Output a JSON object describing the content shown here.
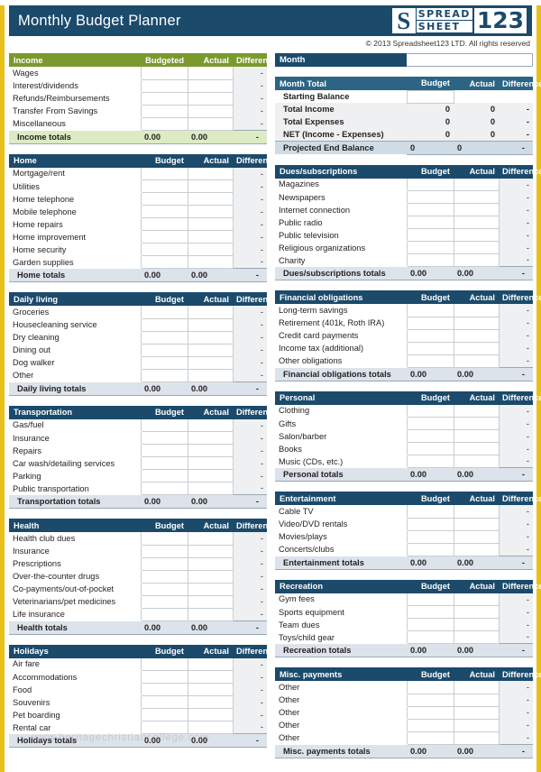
{
  "header": {
    "title": "Monthly Budget Planner",
    "copyright": "© 2013 Spreadsheet123 LTD. All rights reserved",
    "logo": {
      "mark": "S",
      "word1": "SPREAD",
      "word2": "SHEET",
      "number": "123"
    }
  },
  "watermark": "www.heritagechristiancollege.com",
  "colors": {
    "header_navy": "#1B4A6B",
    "income_green": "#7A9A2E",
    "total_blue": "#2C6484",
    "border_gold": "#E8C018",
    "totals_row": "#DCE3EA",
    "income_totals_row": "#DDEBC4",
    "difference_cell": "#EFF0F1"
  },
  "month": {
    "label": "Month",
    "value": "",
    "placeholder": ""
  },
  "columns": {
    "left": [
      {
        "key": "income",
        "style": "income",
        "headers": {
          "name": "Income",
          "budget": "Budgeted",
          "actual": "Actual",
          "difference": "Difference"
        },
        "rows": [
          {
            "name": "Wages",
            "budget": "",
            "actual": "",
            "difference": "-"
          },
          {
            "name": "Interest/dividends",
            "budget": "",
            "actual": "",
            "difference": "-"
          },
          {
            "name": "Refunds/Reimbursements",
            "budget": "",
            "actual": "",
            "difference": "-"
          },
          {
            "name": "Transfer From Savings",
            "budget": "",
            "actual": "",
            "difference": "-"
          },
          {
            "name": "Miscellaneous",
            "budget": "",
            "actual": "",
            "difference": "-"
          }
        ],
        "totals": {
          "name": "Income totals",
          "budget": "0.00",
          "actual": "0.00",
          "difference": "-"
        }
      },
      {
        "key": "home",
        "style": "expense",
        "headers": {
          "name": "Home",
          "budget": "Budget",
          "actual": "Actual",
          "difference": "Difference"
        },
        "rows": [
          {
            "name": "Mortgage/rent",
            "budget": "",
            "actual": "",
            "difference": "-"
          },
          {
            "name": "Utilities",
            "budget": "",
            "actual": "",
            "difference": "-"
          },
          {
            "name": "Home telephone",
            "budget": "",
            "actual": "",
            "difference": "-"
          },
          {
            "name": "Mobile telephone",
            "budget": "",
            "actual": "",
            "difference": "-"
          },
          {
            "name": "Home repairs",
            "budget": "",
            "actual": "",
            "difference": "-"
          },
          {
            "name": "Home improvement",
            "budget": "",
            "actual": "",
            "difference": "-"
          },
          {
            "name": "Home security",
            "budget": "",
            "actual": "",
            "difference": "-"
          },
          {
            "name": "Garden supplies",
            "budget": "",
            "actual": "",
            "difference": "-"
          }
        ],
        "totals": {
          "name": "Home totals",
          "budget": "0.00",
          "actual": "0.00",
          "difference": "-"
        }
      },
      {
        "key": "daily-living",
        "style": "expense",
        "headers": {
          "name": "Daily living",
          "budget": "Budget",
          "actual": "Actual",
          "difference": "Difference"
        },
        "rows": [
          {
            "name": "Groceries",
            "budget": "",
            "actual": "",
            "difference": "-"
          },
          {
            "name": "Housecleaning service",
            "budget": "",
            "actual": "",
            "difference": "-"
          },
          {
            "name": "Dry cleaning",
            "budget": "",
            "actual": "",
            "difference": "-"
          },
          {
            "name": "Dining out",
            "budget": "",
            "actual": "",
            "difference": "-"
          },
          {
            "name": "Dog walker",
            "budget": "",
            "actual": "",
            "difference": "-"
          },
          {
            "name": "Other",
            "budget": "",
            "actual": "",
            "difference": "-"
          }
        ],
        "totals": {
          "name": "Daily living totals",
          "budget": "0.00",
          "actual": "0.00",
          "difference": "-"
        }
      },
      {
        "key": "transportation",
        "style": "expense",
        "headers": {
          "name": "Transportation",
          "budget": "Budget",
          "actual": "Actual",
          "difference": "Difference"
        },
        "rows": [
          {
            "name": "Gas/fuel",
            "budget": "",
            "actual": "",
            "difference": "-"
          },
          {
            "name": "Insurance",
            "budget": "",
            "actual": "",
            "difference": "-"
          },
          {
            "name": "Repairs",
            "budget": "",
            "actual": "",
            "difference": "-"
          },
          {
            "name": "Car wash/detailing services",
            "budget": "",
            "actual": "",
            "difference": "-"
          },
          {
            "name": "Parking",
            "budget": "",
            "actual": "",
            "difference": "-"
          },
          {
            "name": "Public transportation",
            "budget": "",
            "actual": "",
            "difference": "-"
          }
        ],
        "totals": {
          "name": "Transportation totals",
          "budget": "0.00",
          "actual": "0.00",
          "difference": "-"
        }
      },
      {
        "key": "health",
        "style": "expense",
        "headers": {
          "name": "Health",
          "budget": "Budget",
          "actual": "Actual",
          "difference": "Difference"
        },
        "rows": [
          {
            "name": "Health club dues",
            "budget": "",
            "actual": "",
            "difference": "-"
          },
          {
            "name": "Insurance",
            "budget": "",
            "actual": "",
            "difference": "-"
          },
          {
            "name": "Prescriptions",
            "budget": "",
            "actual": "",
            "difference": "-"
          },
          {
            "name": "Over-the-counter drugs",
            "budget": "",
            "actual": "",
            "difference": "-"
          },
          {
            "name": "Co-payments/out-of-pocket",
            "budget": "",
            "actual": "",
            "difference": "-"
          },
          {
            "name": "Veterinarians/pet medicines",
            "budget": "",
            "actual": "",
            "difference": "-"
          },
          {
            "name": "Life insurance",
            "budget": "",
            "actual": "",
            "difference": "-"
          }
        ],
        "totals": {
          "name": "Health totals",
          "budget": "0.00",
          "actual": "0.00",
          "difference": "-"
        }
      },
      {
        "key": "holidays",
        "style": "expense",
        "headers": {
          "name": "Holidays",
          "budget": "Budget",
          "actual": "Actual",
          "difference": "Difference"
        },
        "rows": [
          {
            "name": "Air fare",
            "budget": "",
            "actual": "",
            "difference": "-"
          },
          {
            "name": "Accommodations",
            "budget": "",
            "actual": "",
            "difference": "-"
          },
          {
            "name": "Food",
            "budget": "",
            "actual": "",
            "difference": "-"
          },
          {
            "name": "Souvenirs",
            "budget": "",
            "actual": "",
            "difference": "-"
          },
          {
            "name": "Pet boarding",
            "budget": "",
            "actual": "",
            "difference": "-"
          },
          {
            "name": "Rental car",
            "budget": "",
            "actual": "",
            "difference": "-"
          }
        ],
        "totals": {
          "name": "Holidays totals",
          "budget": "0.00",
          "actual": "0.00",
          "difference": "-"
        }
      }
    ],
    "right": [
      {
        "key": "month-total",
        "style": "total",
        "headers": {
          "name": "Month Total",
          "budget": "Budget",
          "actual": "Actual",
          "difference": "Difference"
        },
        "rows": [
          {
            "name": "Starting Balance",
            "budget": "",
            "actual": "",
            "difference": "",
            "input": true
          },
          {
            "name": "Total Income",
            "budget": "0",
            "actual": "0",
            "difference": "-"
          },
          {
            "name": "Total Expenses",
            "budget": "0",
            "actual": "0",
            "difference": "-"
          },
          {
            "name": "NET (Income - Expenses)",
            "budget": "0",
            "actual": "0",
            "difference": "-"
          }
        ],
        "totals": {
          "name": "Projected End Balance",
          "budget": "0",
          "actual": "0",
          "difference": "-"
        }
      },
      {
        "key": "dues-subscriptions",
        "style": "expense",
        "headers": {
          "name": "Dues/subscriptions",
          "budget": "Budget",
          "actual": "Actual",
          "difference": "Difference"
        },
        "rows": [
          {
            "name": "Magazines",
            "budget": "",
            "actual": "",
            "difference": "-"
          },
          {
            "name": "Newspapers",
            "budget": "",
            "actual": "",
            "difference": "-"
          },
          {
            "name": "Internet connection",
            "budget": "",
            "actual": "",
            "difference": "-"
          },
          {
            "name": "Public radio",
            "budget": "",
            "actual": "",
            "difference": "-"
          },
          {
            "name": "Public television",
            "budget": "",
            "actual": "",
            "difference": "-"
          },
          {
            "name": "Religious organizations",
            "budget": "",
            "actual": "",
            "difference": "-"
          },
          {
            "name": "Charity",
            "budget": "",
            "actual": "",
            "difference": "-"
          }
        ],
        "totals": {
          "name": "Dues/subscriptions totals",
          "budget": "0.00",
          "actual": "0.00",
          "difference": "-"
        }
      },
      {
        "key": "financial-obligations",
        "style": "expense",
        "headers": {
          "name": "Financial obligations",
          "budget": "Budget",
          "actual": "Actual",
          "difference": "Difference"
        },
        "rows": [
          {
            "name": "Long-term savings",
            "budget": "",
            "actual": "",
            "difference": "-"
          },
          {
            "name": "Retirement (401k, Roth IRA)",
            "budget": "",
            "actual": "",
            "difference": "-"
          },
          {
            "name": "Credit card payments",
            "budget": "",
            "actual": "",
            "difference": "-"
          },
          {
            "name": "Income tax (additional)",
            "budget": "",
            "actual": "",
            "difference": "-"
          },
          {
            "name": "Other obligations",
            "budget": "",
            "actual": "",
            "difference": "-"
          }
        ],
        "totals": {
          "name": "Financial obligations totals",
          "budget": "0.00",
          "actual": "0.00",
          "difference": "-"
        }
      },
      {
        "key": "personal",
        "style": "expense",
        "headers": {
          "name": "Personal",
          "budget": "Budget",
          "actual": "Actual",
          "difference": "Difference"
        },
        "rows": [
          {
            "name": "Clothing",
            "budget": "",
            "actual": "",
            "difference": "-"
          },
          {
            "name": "Gifts",
            "budget": "",
            "actual": "",
            "difference": "-"
          },
          {
            "name": "Salon/barber",
            "budget": "",
            "actual": "",
            "difference": "-"
          },
          {
            "name": "Books",
            "budget": "",
            "actual": "",
            "difference": "-"
          },
          {
            "name": "Music (CDs, etc.)",
            "budget": "",
            "actual": "",
            "difference": "-"
          }
        ],
        "totals": {
          "name": "Personal totals",
          "budget": "0.00",
          "actual": "0.00",
          "difference": "-"
        }
      },
      {
        "key": "entertainment",
        "style": "expense",
        "headers": {
          "name": "Entertainment",
          "budget": "Budget",
          "actual": "Actual",
          "difference": "Difference"
        },
        "rows": [
          {
            "name": "Cable TV",
            "budget": "",
            "actual": "",
            "difference": "-"
          },
          {
            "name": "Video/DVD rentals",
            "budget": "",
            "actual": "",
            "difference": "-"
          },
          {
            "name": "Movies/plays",
            "budget": "",
            "actual": "",
            "difference": "-"
          },
          {
            "name": "Concerts/clubs",
            "budget": "",
            "actual": "",
            "difference": "-"
          }
        ],
        "totals": {
          "name": "Entertainment totals",
          "budget": "0.00",
          "actual": "0.00",
          "difference": "-"
        }
      },
      {
        "key": "recreation",
        "style": "expense",
        "headers": {
          "name": "Recreation",
          "budget": "Budget",
          "actual": "Actual",
          "difference": "Difference"
        },
        "rows": [
          {
            "name": "Gym fees",
            "budget": "",
            "actual": "",
            "difference": "-"
          },
          {
            "name": "Sports equipment",
            "budget": "",
            "actual": "",
            "difference": "-"
          },
          {
            "name": "Team dues",
            "budget": "",
            "actual": "",
            "difference": "-"
          },
          {
            "name": "Toys/child gear",
            "budget": "",
            "actual": "",
            "difference": "-"
          }
        ],
        "totals": {
          "name": "Recreation totals",
          "budget": "0.00",
          "actual": "0.00",
          "difference": "-"
        }
      },
      {
        "key": "misc-payments",
        "style": "expense",
        "headers": {
          "name": "Misc. payments",
          "budget": "Budget",
          "actual": "Actual",
          "difference": "Difference"
        },
        "rows": [
          {
            "name": "Other",
            "budget": "",
            "actual": "",
            "difference": "-"
          },
          {
            "name": "Other",
            "budget": "",
            "actual": "",
            "difference": "-"
          },
          {
            "name": "Other",
            "budget": "",
            "actual": "",
            "difference": "-"
          },
          {
            "name": "Other",
            "budget": "",
            "actual": "",
            "difference": "-"
          },
          {
            "name": "Other",
            "budget": "",
            "actual": "",
            "difference": "-"
          }
        ],
        "totals": {
          "name": "Misc. payments totals",
          "budget": "0.00",
          "actual": "0.00",
          "difference": "-"
        }
      }
    ]
  }
}
